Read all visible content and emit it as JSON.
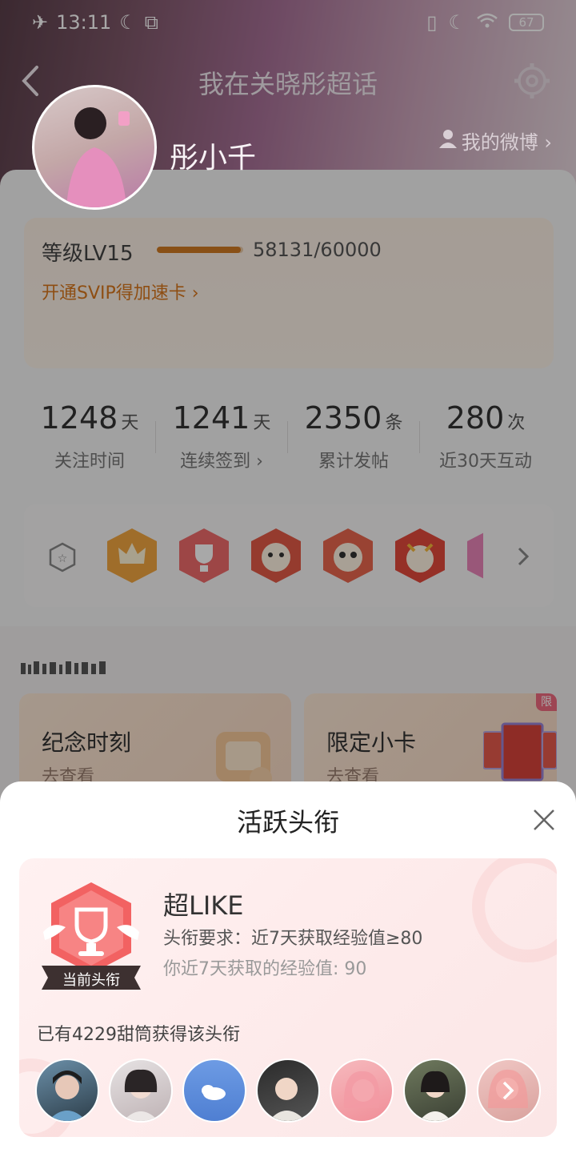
{
  "status_bar": {
    "time": "13:11",
    "battery": "67"
  },
  "header": {
    "title": "我在关晓彤超话",
    "username": "彤小千",
    "my_weibo": "我的微博 ›"
  },
  "level": {
    "label": "等级LV15",
    "progress_text": "58131/60000",
    "progress_fraction": 0.969,
    "svip_link": "开通SVIP得加速卡 ›"
  },
  "stats": [
    {
      "value": "1248",
      "unit": "天",
      "label": "关注时间"
    },
    {
      "value": "1241",
      "unit": "天",
      "label": "连续签到 ›"
    },
    {
      "value": "2350",
      "unit": "条",
      "label": "累计发帖"
    },
    {
      "value": "280",
      "unit": "次",
      "label": "近30天互动"
    }
  ],
  "badges": [
    "crown-badge-icon",
    "trophy-badge-icon",
    "mascot-badge-icon",
    "mascot-badge-icon",
    "dragon-badge-icon",
    "partial-badge-icon"
  ],
  "features": [
    {
      "title": "纪念时刻",
      "subtitle": "去查看"
    },
    {
      "title": "限定小卡",
      "subtitle": "去查看",
      "tag": "限"
    }
  ],
  "sheet": {
    "title": "活跃头衔",
    "badge_tag": "当前头衔",
    "title_name": "超LIKE",
    "requirement": "头衔要求：近7天获取经验值≥80",
    "your_exp": "你近7天获取的经验值: 90",
    "holders_count": "已有4229甜筒获得该头衔"
  },
  "colors": {
    "accent_orange": "#d8771d",
    "badge_red": "#ef5555",
    "sheet_bg": "#fdeaea"
  }
}
